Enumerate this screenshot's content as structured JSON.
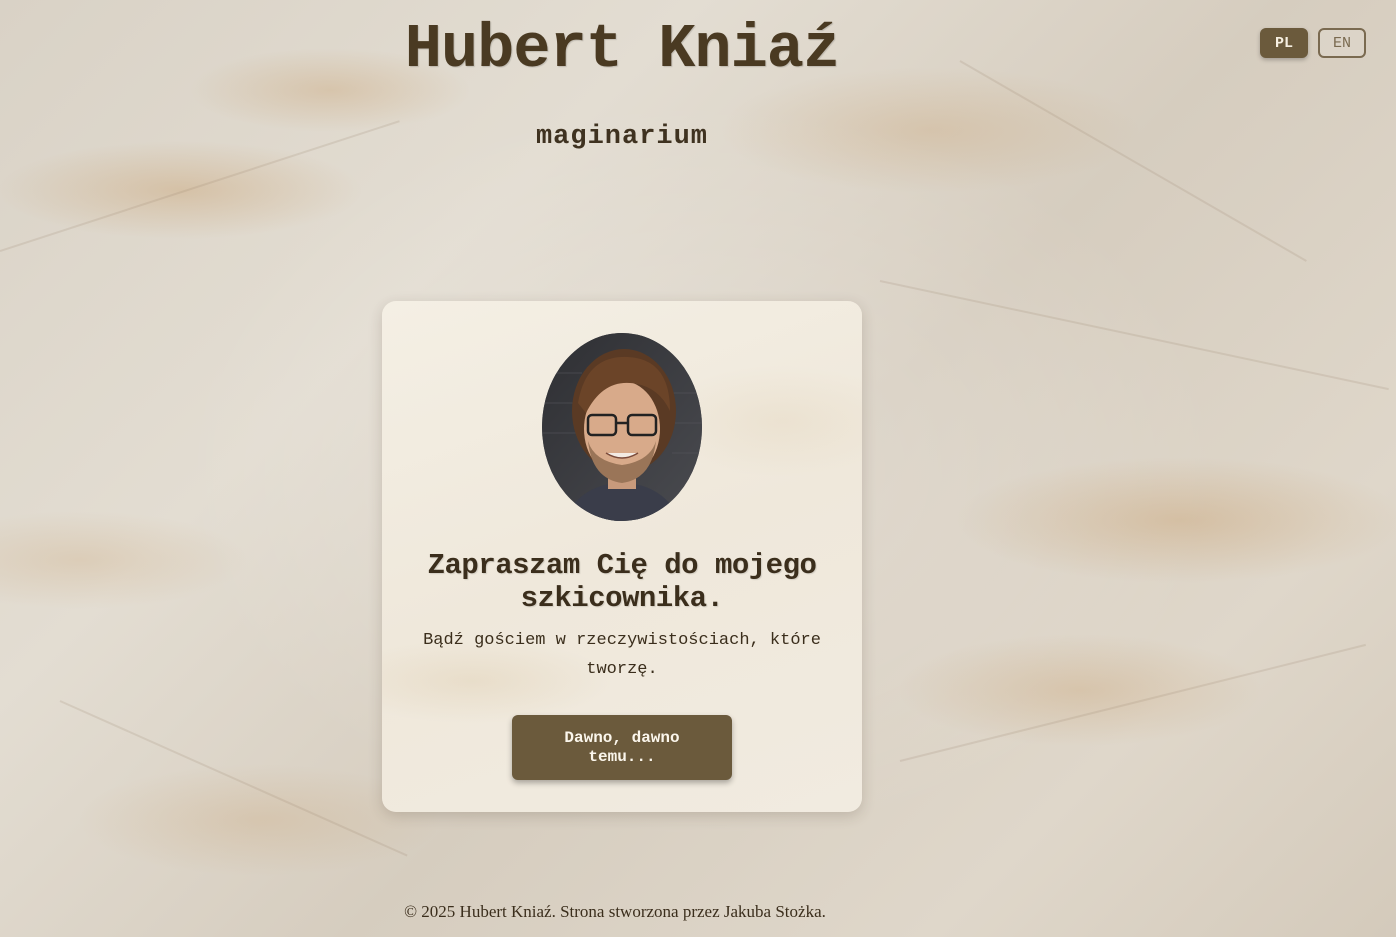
{
  "header": {
    "title": "Hubert Kniaź",
    "subtitle": "maginarium"
  },
  "language_switch": {
    "options": [
      "PL",
      "EN"
    ],
    "active": "PL"
  },
  "intro_card": {
    "avatar_icon": "portrait-photo",
    "headline": "Zapraszam Cię do mojego szkicownika.",
    "lead": "Bądź gościem w rzeczywistościach, które tworzę.",
    "cta_label": "Dawno, dawno temu..."
  },
  "footer": {
    "text": "© 2025 Hubert Kniaź. Strona stworzona przez Jakuba Stożka."
  },
  "colors": {
    "paper": "#dcd4c7",
    "card": "#f2ece1",
    "accent": "#6b5a3c",
    "text": "#3b2e1c"
  }
}
